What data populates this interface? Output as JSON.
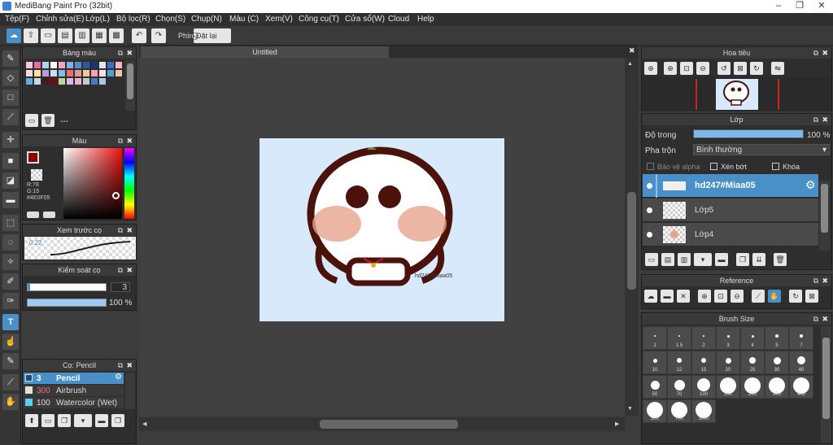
{
  "app": {
    "title": "MediBang Paint Pro (32bit)"
  },
  "menu": [
    "Tệp(F)",
    "Chỉnh sửa(E)",
    "Lớp(L)",
    "Bộ lọc(R)",
    "Chọn(S)",
    "Chụp(N)",
    "Màu (C)",
    "Xem(V)",
    "Công cụ(T)",
    "Cửa sổ(W)",
    "Cloud",
    "Help"
  ],
  "toolbar": {
    "shortcut_label": "Phím",
    "reset_label": "Đặt lại"
  },
  "palette": {
    "title": "Bảng màu",
    "page": "---",
    "swatches": [
      "#f9c9d8",
      "#e96aa0",
      "#b5d3f0",
      "#ffffff",
      "#f2a7c0",
      "#7fb2e5",
      "#5a8ac5",
      "#2c5aa0",
      "#18386f",
      "#e5e5f0",
      "#3a6ec0",
      "#f7b6c9",
      "#f4d7e1",
      "#fbe0a0",
      "#b89ad8",
      "#c7e0f4",
      "#8ab9e7",
      "#f26a6a",
      "#d89a9a",
      "#f0c890",
      "#f8a0b8",
      "#fce0e8",
      "#4aa3d6",
      "#f5c19a",
      "#6aa8d8",
      "#bfd8f0",
      "#3b1e14",
      "#6a1010",
      "#b8d8a0",
      "#d8b8e8",
      "#f0b0c8",
      "#c0c8d8",
      "#4a7ab8",
      "#a8c8e8"
    ]
  },
  "color": {
    "title": "Màu",
    "r": "R:78",
    "g": "G:15",
    "b": "B:5",
    "hex": "#4E0F05",
    "primary": "#8b0000"
  },
  "brush_preview": {
    "title": "Xem trước cọ",
    "size": "0.22"
  },
  "brush_control": {
    "title": "Kiểm soát cọ",
    "size": "3",
    "opacity": "100 %"
  },
  "brush_list": {
    "title": "Cọ: Pencil",
    "items": [
      {
        "size": "3",
        "name": "Pencil",
        "color": "#1e4a7a",
        "selected": true
      },
      {
        "size": "300",
        "name": "Airbrush",
        "color": "#e0e0e0",
        "selected": false
      },
      {
        "size": "100",
        "name": "Watercolor (Wet)",
        "color": "#5ad0f0",
        "selected": false
      }
    ]
  },
  "canvas": {
    "tab": "Untitled",
    "watermark": "hd247#Miaa05"
  },
  "navigator": {
    "title": "Hoa tiêu"
  },
  "layers": {
    "title": "Lớp",
    "opacity_label": "Độ trong",
    "opacity_value": "100 %",
    "opacity_fraction": 1.0,
    "blend_label": "Pha trộn",
    "blend_value": "Bình thường",
    "protect_alpha": "Bảo vệ alpha",
    "clipping": "Xén bớt",
    "lock": "Khóa",
    "items": [
      {
        "name": "hd247#Miaa05",
        "selected": true
      },
      {
        "name": "Lớp5",
        "selected": false
      },
      {
        "name": "Lớp4",
        "selected": false
      }
    ]
  },
  "reference": {
    "title": "Reference"
  },
  "brush_size": {
    "title": "Brush Size",
    "sizes": [
      "1",
      "1.5",
      "2",
      "3",
      "4",
      "5",
      "7",
      "10",
      "12",
      "15",
      "20",
      "25",
      "30",
      "40",
      "50",
      "70",
      "100",
      "150",
      "200",
      "300",
      "400",
      "500",
      "700",
      "1000"
    ]
  }
}
